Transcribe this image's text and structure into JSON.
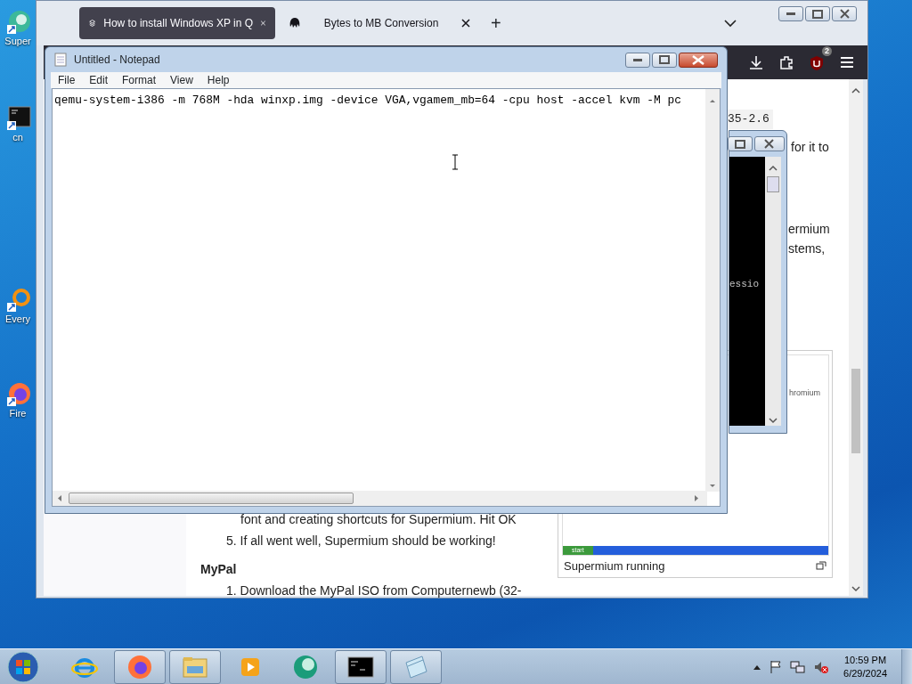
{
  "desktop_icons": [
    {
      "kind": "app",
      "label": "Super"
    },
    {
      "kind": "console",
      "label": "cn"
    },
    {
      "kind": "search",
      "label": "Every"
    },
    {
      "kind": "firefox",
      "label": "Fire"
    }
  ],
  "browser": {
    "tabs": [
      {
        "label": "How to install Windows XP in Q",
        "selected": true
      },
      {
        "label": "Bytes to MB Conversion",
        "selected": false
      }
    ],
    "new_tab": "+",
    "extensions_badge": "2",
    "page": {
      "code_fragment": "35-2.6",
      "fragments": [
        "for it to",
        "ermium",
        "stems,"
      ],
      "list_tail": "font and creating shortcuts for Supermium. Hit OK",
      "list_items": [
        {
          "number": "5.",
          "text": "If all went well, Supermium should be working!"
        }
      ],
      "heading": "MyPal",
      "list2": [
        {
          "number": "1.",
          "text": "Download the MyPal ISO from Computernewb (32-"
        }
      ],
      "figure": {
        "screenshot_title": "hromium",
        "screenshot_start": "start",
        "caption": "Supermium running"
      }
    }
  },
  "console": {
    "text": "essio"
  },
  "notepad": {
    "title": "Untitled - Notepad",
    "menu": [
      "File",
      "Edit",
      "Format",
      "View",
      "Help"
    ],
    "content": "qemu-system-i386 -m 768M -hda winxp.img -device VGA,vgamem_mb=64 -cpu host -accel kvm -M pc"
  },
  "taskbar": {
    "apps": [
      {
        "kind": "ie",
        "running": false
      },
      {
        "kind": "firefox",
        "running": true
      },
      {
        "kind": "explorer",
        "running": true
      },
      {
        "kind": "media",
        "running": false
      },
      {
        "kind": "green",
        "running": false
      },
      {
        "kind": "console",
        "running": true
      },
      {
        "kind": "notepad",
        "running": true
      }
    ],
    "time": "10:59 PM",
    "date": "6/29/2024"
  }
}
